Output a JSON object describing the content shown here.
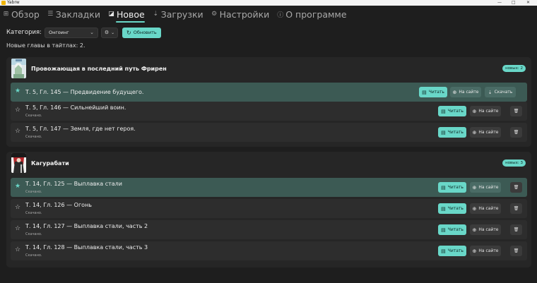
{
  "window": {
    "title": "Yabrw",
    "min": "—",
    "max": "□",
    "close": "✕"
  },
  "tabs": [
    {
      "label": "Обзор",
      "icon": "⊞",
      "active": false
    },
    {
      "label": "Закладки",
      "icon": "☰",
      "active": false
    },
    {
      "label": "Новое",
      "icon": "◪",
      "active": true
    },
    {
      "label": "Загрузки",
      "icon": "⇣",
      "active": false
    },
    {
      "label": "Настройки",
      "icon": "⚙",
      "active": false
    },
    {
      "label": "О программе",
      "icon": "ⓘ",
      "active": false
    }
  ],
  "toolbar": {
    "category_label": "Категория:",
    "category_value": "Онгоинг",
    "filter_icon": "⚙",
    "refresh_label": "Обновить"
  },
  "summary": "Новые главы в тайтлах: 2.",
  "groups": [
    {
      "title": "Провожающая в последний путь Фрирен",
      "badge": "новых: 2",
      "rows": [
        {
          "title": "Т. 5, Гл. 145 — Предвидение будущего.",
          "status": "",
          "read": "Читать",
          "site": "На сайте",
          "download": "Скачать"
        },
        {
          "title": "Т. 5, Гл. 146 — Сильнейший воин.",
          "status": "Скачано.",
          "read": "Читать",
          "site": "На сайте"
        },
        {
          "title": "Т. 5, Гл. 147 — Земля, где нет героя.",
          "status": "Скачано.",
          "read": "Читать",
          "site": "На сайте"
        }
      ]
    },
    {
      "title": "Кагурабати",
      "badge": "новых: 3",
      "rows": [
        {
          "title": "Т. 14, Гл. 125 — Выплавка стали",
          "status": "Скачано.",
          "read": "Читать",
          "site": "На сайте"
        },
        {
          "title": "Т. 14, Гл. 126 — Огонь",
          "status": "Скачано.",
          "read": "Читать",
          "site": "На сайте"
        },
        {
          "title": "Т. 14, Гл. 127 — Выплавка стали, часть 2",
          "status": "Скачано.",
          "read": "Читать",
          "site": "На сайте"
        },
        {
          "title": "Т. 14, Гл. 128 — Выплавка стали, часть 3",
          "status": "Скачано.",
          "read": "Читать",
          "site": "На сайте"
        }
      ]
    }
  ],
  "colors": {
    "accent": "#69d7c8",
    "bg": "#1e1e1e",
    "card": "#262626",
    "row": "#2d2d2d",
    "row_highlight": "#3c5a54"
  }
}
